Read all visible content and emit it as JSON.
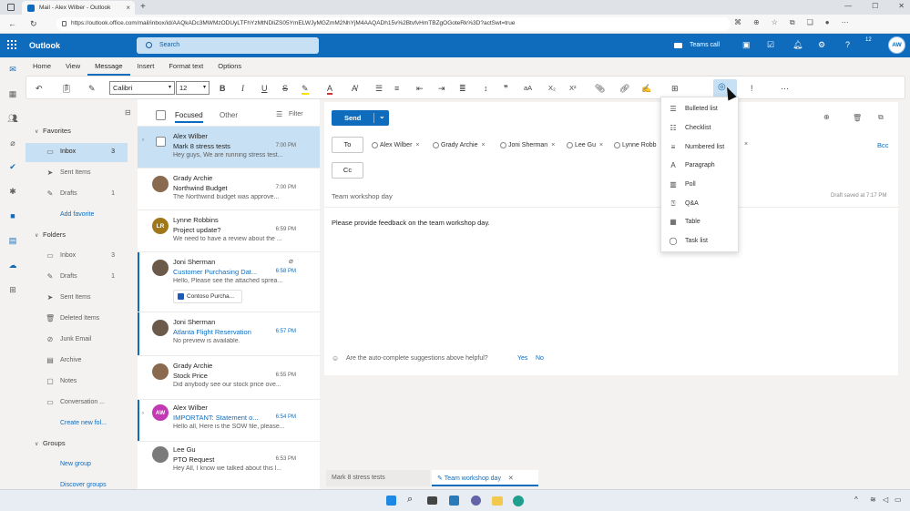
{
  "browser": {
    "tab_title": "Mail - Alex Wilber - Outlook",
    "url": "https://outlook.office.com/mail/inbox/id/AAQkADc3MWMzODUyLTFhYzMtNDliZS05YmELWJyMGZmM2NhYjM4AAQADh15v%2BtvfvHmTBZgOGoteRk%3D?actSwt=true"
  },
  "app": {
    "brand": "Outlook",
    "search_placeholder": "Search",
    "teams_call": "Teams call",
    "avatar_initials": "AW",
    "notification_count": "12"
  },
  "ribbon_tabs": [
    "Home",
    "View",
    "Message",
    "Insert",
    "Format text",
    "Options"
  ],
  "toolbar": {
    "font": "Calibri",
    "size": "12"
  },
  "folders": {
    "favorites_header": "Favorites",
    "favorites": [
      {
        "label": "Inbox",
        "count": "3",
        "icon": "inbox-icon"
      },
      {
        "label": "Sent Items",
        "count": "",
        "icon": "send-icon"
      },
      {
        "label": "Drafts",
        "count": "1",
        "icon": "pencil-icon"
      },
      {
        "label": "Add favorite",
        "count": "",
        "icon": ""
      }
    ],
    "folders_header": "Folders",
    "folders": [
      {
        "label": "Inbox",
        "count": "3",
        "icon": "inbox-icon"
      },
      {
        "label": "Drafts",
        "count": "1",
        "icon": "pencil-icon"
      },
      {
        "label": "Sent Items",
        "count": "",
        "icon": "send-icon"
      },
      {
        "label": "Deleted Items",
        "count": "",
        "icon": "trash-icon"
      },
      {
        "label": "Junk Email",
        "count": "",
        "icon": "junk-icon"
      },
      {
        "label": "Archive",
        "count": "",
        "icon": "archive-icon"
      },
      {
        "label": "Notes",
        "count": "",
        "icon": "note-icon"
      },
      {
        "label": "Conversation ...",
        "count": "",
        "icon": "folder-icon"
      },
      {
        "label": "Create new fol...",
        "count": "",
        "icon": ""
      }
    ],
    "groups_header": "Groups",
    "groups": [
      {
        "label": "New group"
      },
      {
        "label": "Discover groups"
      }
    ]
  },
  "list": {
    "focused": "Focused",
    "other": "Other",
    "filter": "Filter",
    "messages": [
      {
        "from": "Alex Wilber",
        "subject": "Mark 8 stress tests",
        "time": "7:00 PM",
        "preview": "Hey guys, We are running stress test..."
      },
      {
        "from": "Grady Archie",
        "subject": "Northwind Budget",
        "time": "7:00 PM",
        "preview": "The Northwind budget was approve..."
      },
      {
        "from": "Lynne Robbins",
        "subject": "Project update?",
        "time": "6:59 PM",
        "preview": "We need to have a review about the ...",
        "initials": "LR"
      },
      {
        "from": "Joni Sherman",
        "subject": "Customer Purchasing Dat...",
        "time": "6:58 PM",
        "preview": "Hello, Please see the attached sprea...",
        "attachment": "Contoso Purcha..."
      },
      {
        "from": "Joni Sherman",
        "subject": "Atlanta Flight Reservation",
        "time": "6:57 PM",
        "preview": "No preview is available."
      },
      {
        "from": "Grady Archie",
        "subject": "Stock Price",
        "time": "6:55 PM",
        "preview": "Did anybody see our stock price ove..."
      },
      {
        "from": "Alex Wilber",
        "subject": "IMPORTANT: Statement o...",
        "time": "6:54 PM",
        "preview": "Hello all, Here is the SOW file, please...",
        "initials": "AW"
      },
      {
        "from": "Lee Gu",
        "subject": "PTO Request",
        "time": "6:53 PM",
        "preview": "Hey All, I know we talked about this l..."
      }
    ]
  },
  "compose": {
    "send": "Send",
    "to": "To",
    "cc": "Cc",
    "bcc": "Bcc",
    "recipients": [
      "Alex Wilber",
      "Grady Archie",
      "Joni Sherman",
      "Lee Gu",
      "Lynne Robb"
    ],
    "subject": "Team workshop day",
    "draft_saved": "Draft saved at 7:17 PM",
    "body": "Please provide feedback on the team workshop day.",
    "feedback_q": "Are the auto-complete suggestions above helpful?",
    "yes": "Yes",
    "no": "No"
  },
  "loop_menu": [
    {
      "label": "Bulleted list",
      "icon": "bulleted-list-icon"
    },
    {
      "label": "Checklist",
      "icon": "checklist-icon"
    },
    {
      "label": "Numbered list",
      "icon": "numbered-list-icon"
    },
    {
      "label": "Paragraph",
      "icon": "paragraph-icon"
    },
    {
      "label": "Poll",
      "icon": "poll-icon"
    },
    {
      "label": "Q&A",
      "icon": "qa-icon"
    },
    {
      "label": "Table",
      "icon": "table-icon"
    },
    {
      "label": "Task list",
      "icon": "task-list-icon"
    }
  ],
  "bottom_tabs": [
    "Mark 8 stress tests",
    "Team workshop day"
  ],
  "colors": {
    "brand": "#0f6cbd",
    "selection": "#c7e0f4"
  }
}
